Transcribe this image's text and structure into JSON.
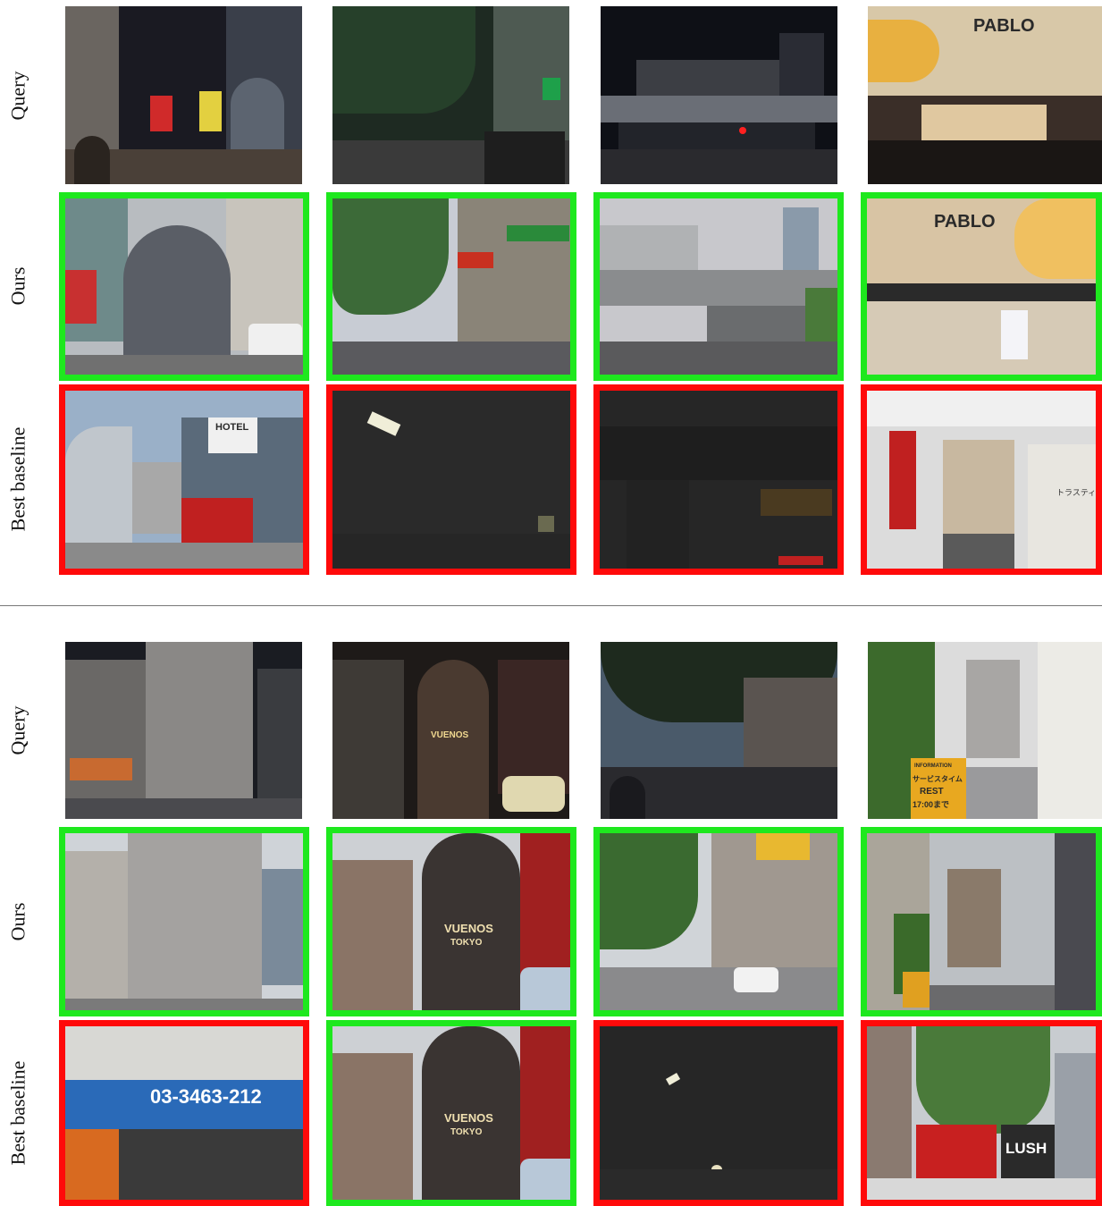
{
  "row_labels": [
    "Query",
    "Ours",
    "Best baseline"
  ],
  "sign_texts": {
    "pablo": "PABLO",
    "hotel": "HOTEL",
    "vuenos": "VUENOS",
    "tokyo": "TOKYO",
    "phone": "03-3463-212",
    "lush": "LUSH",
    "information": "INFORMATION",
    "service": "サービスタイム",
    "rest": "REST",
    "time": "17:00まで",
    "hotel_name": "トラスティ"
  },
  "colors": {
    "correct": "#1ee81e",
    "wrong": "#ff0a0a"
  }
}
